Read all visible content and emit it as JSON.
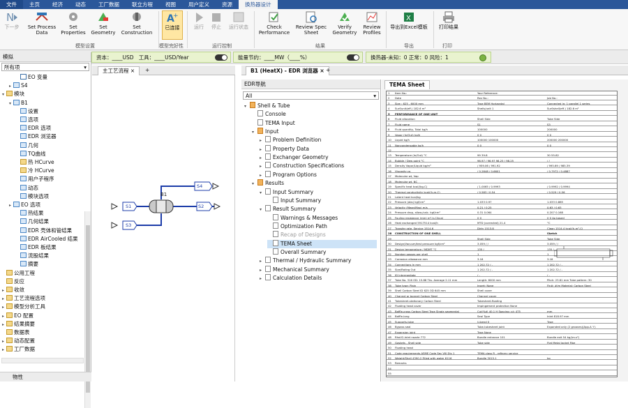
{
  "menu": [
    "文件",
    "主页",
    "经济",
    "动态",
    "工厂数据",
    "联立方程",
    "视图",
    "用户定义",
    "资源",
    "换热器设计"
  ],
  "ribbon": {
    "buttons": [
      {
        "label": "下一步",
        "disabled": true
      },
      {
        "label": "Set Process\nData"
      },
      {
        "label": "Set\nProperties"
      },
      {
        "label": "Set\nGeometry"
      },
      {
        "label": "Set\nConstruction"
      },
      {
        "label": "已连接"
      },
      {
        "label": "运行",
        "disabled": true
      },
      {
        "label": "停止",
        "disabled": true
      },
      {
        "label": "运行状态",
        "disabled": true
      },
      {
        "label": "Check\nPerformance"
      },
      {
        "label": "Review Spec\nSheet"
      },
      {
        "label": "Verify\nGeometry"
      },
      {
        "label": "Review\nProfiles"
      },
      {
        "label": "导出到Excel模板"
      },
      {
        "label": "打印结果"
      }
    ],
    "groups": [
      "模型设置",
      "模型完好性",
      "运行控制",
      "结果",
      "导出",
      "打印"
    ]
  },
  "status": {
    "capital": "资本：____USD",
    "utilities": "工具：____USD/Year",
    "energy": "能量节约：____MW（____%）",
    "hx": "换热器-未知：0  正常：0  风险：1"
  },
  "left": {
    "header": "模拟",
    "filter": "所有项",
    "tree": [
      {
        "t": "EO 变量",
        "lv": 2,
        "tg": "",
        "ic": "doc"
      },
      {
        "t": "S4",
        "lv": 1,
        "tg": "▸",
        "ic": "blk"
      },
      {
        "t": "模块",
        "lv": 0,
        "tg": "▾",
        "ic": "fold"
      },
      {
        "t": "B1",
        "lv": 1,
        "tg": "▾",
        "ic": "blk"
      },
      {
        "t": "设置",
        "lv": 2,
        "tg": "",
        "ic": "blk"
      },
      {
        "t": "选项",
        "lv": 2,
        "tg": "",
        "ic": "blk"
      },
      {
        "t": "EDR 选项",
        "lv": 2,
        "tg": "",
        "ic": "blk"
      },
      {
        "t": "EDR 浏览器",
        "lv": 2,
        "tg": "",
        "ic": "blk"
      },
      {
        "t": "几何",
        "lv": 2,
        "tg": "",
        "ic": "blk"
      },
      {
        "t": "TQ曲线",
        "lv": 2,
        "tg": "",
        "ic": "blk"
      },
      {
        "t": "热 HCurve",
        "lv": 2,
        "tg": "",
        "ic": "fold"
      },
      {
        "t": "冷 HCurve",
        "lv": 2,
        "tg": "",
        "ic": "fold"
      },
      {
        "t": "用户子程序",
        "lv": 2,
        "tg": "",
        "ic": "blk"
      },
      {
        "t": "动态",
        "lv": 2,
        "tg": "",
        "ic": "blk"
      },
      {
        "t": "模块选项",
        "lv": 2,
        "tg": "",
        "ic": "blk"
      },
      {
        "t": "EO 选项",
        "lv": 1,
        "tg": "▸",
        "ic": "blk"
      },
      {
        "t": "热结果",
        "lv": 2,
        "tg": "",
        "ic": "blk"
      },
      {
        "t": "几何结果",
        "lv": 2,
        "tg": "",
        "ic": "blk"
      },
      {
        "t": "EDR 壳体和管结果",
        "lv": 2,
        "tg": "",
        "ic": "blk"
      },
      {
        "t": "EDR AirCooled 结果",
        "lv": 2,
        "tg": "",
        "ic": "blk"
      },
      {
        "t": "EDR 板结果",
        "lv": 2,
        "tg": "",
        "ic": "blk"
      },
      {
        "t": "流股结果",
        "lv": 2,
        "tg": "",
        "ic": "blk"
      },
      {
        "t": "摘要",
        "lv": 2,
        "tg": "",
        "ic": "blk"
      },
      {
        "t": "公用工程",
        "lv": 0,
        "tg": "",
        "ic": "fold"
      },
      {
        "t": "反应",
        "lv": 0,
        "tg": "",
        "ic": "fold"
      },
      {
        "t": "收敛",
        "lv": 0,
        "tg": "▸",
        "ic": "fold"
      },
      {
        "t": "工艺流程选项",
        "lv": 0,
        "tg": "▸",
        "ic": "fold"
      },
      {
        "t": "模型分析工具",
        "lv": 0,
        "tg": "▸",
        "ic": "fold"
      },
      {
        "t": "EO 配置",
        "lv": 0,
        "tg": "▸",
        "ic": "fold"
      },
      {
        "t": "结果摘要",
        "lv": 0,
        "tg": "▸",
        "ic": "fold"
      },
      {
        "t": "数据表",
        "lv": 0,
        "tg": "",
        "ic": "fold"
      },
      {
        "t": "动态配置",
        "lv": 0,
        "tg": "▸",
        "ic": "fold"
      },
      {
        "t": "工厂数据",
        "lv": 0,
        "tg": "▸",
        "ic": "fold"
      }
    ],
    "bottom": "物性"
  },
  "mid": {
    "tab": "主工艺流程",
    "block": "B1",
    "streams": [
      "S1",
      "S2",
      "S3",
      "S4"
    ]
  },
  "right": {
    "tab": "B1 (HeatX) - EDR 浏览器",
    "nav_header": "EDR导航",
    "nav_filter": "All",
    "doc_tab": "TEMA Sheet",
    "nav": [
      {
        "t": "Shell & Tube",
        "lv": 0,
        "ar": "▾",
        "ic": "fd"
      },
      {
        "t": "Console",
        "lv": 1,
        "ar": "",
        "ic": "pg"
      },
      {
        "t": "TEMA Input",
        "lv": 1,
        "ar": "",
        "ic": "pg"
      },
      {
        "t": "Input",
        "lv": 1,
        "ar": "▾",
        "ic": "fd"
      },
      {
        "t": "Problem Definition",
        "lv": 2,
        "ar": "▸",
        "ic": "pg"
      },
      {
        "t": "Property Data",
        "lv": 2,
        "ar": "▸",
        "ic": "pg"
      },
      {
        "t": "Exchanger Geometry",
        "lv": 2,
        "ar": "▸",
        "ic": "pg"
      },
      {
        "t": "Construction Specifications",
        "lv": 2,
        "ar": "▸",
        "ic": "pg"
      },
      {
        "t": "Program Options",
        "lv": 2,
        "ar": "▸",
        "ic": "pg"
      },
      {
        "t": "Results",
        "lv": 1,
        "ar": "▾",
        "ic": "fd"
      },
      {
        "t": "Input Summary",
        "lv": 2,
        "ar": "▾",
        "ic": "pg"
      },
      {
        "t": "Input Summary",
        "lv": 3,
        "ar": "",
        "ic": "pg"
      },
      {
        "t": "Result Summary",
        "lv": 2,
        "ar": "▾",
        "ic": "pg"
      },
      {
        "t": "Warnings & Messages",
        "lv": 3,
        "ar": "",
        "ic": "pg"
      },
      {
        "t": "Optimization Path",
        "lv": 3,
        "ar": "",
        "ic": "pg"
      },
      {
        "t": "Recap of Designs",
        "lv": 3,
        "ar": "",
        "ic": "pg",
        "gray": true
      },
      {
        "t": "TEMA Sheet",
        "lv": 3,
        "ar": "",
        "ic": "pg",
        "sel": true
      },
      {
        "t": "Overall Summary",
        "lv": 3,
        "ar": "",
        "ic": "pg"
      },
      {
        "t": "Thermal / Hydraulic Summary",
        "lv": 2,
        "ar": "▸",
        "ic": "pg"
      },
      {
        "t": "Mechanical Summary",
        "lv": 2,
        "ar": "▸",
        "ic": "pg"
      },
      {
        "t": "Calculation Details",
        "lv": 2,
        "ar": "▸",
        "ic": "pg"
      }
    ]
  },
  "tema": [
    {
      "n": "1",
      "a": "Item No.:",
      "b": "Your Reference:",
      "c": "",
      "d": ""
    },
    {
      "n": "2",
      "a": "Date",
      "b": "Rev No.:",
      "c": "Job No.:",
      "d": ""
    },
    {
      "n": "3",
      "a": "Size :  625 - 6000   mm",
      "b": "Type  BEM   Horizontal",
      "c": "Connected in:  1  parallel   1  series",
      "d": ""
    },
    {
      "n": "4",
      "a": "Surf/unit(eff.)    182.6   m²",
      "b": "Shells/unit   1",
      "c": "Surf/shell(eff.)   182.6   m²",
      "d": ""
    },
    {
      "n": "5",
      "a": "PERFORMANCE OF ONE UNIT",
      "b": "",
      "c": "",
      "d": "",
      "hd": true
    },
    {
      "n": "6",
      "a": "Fluid allocation",
      "b": "Shell Side",
      "c": "Tube Side",
      "d": ""
    },
    {
      "n": "7",
      "a": "Fluid name",
      "b": "S1",
      "c": "S3",
      "d": ""
    },
    {
      "n": "8",
      "a": "Fluid quantity, Total   kg/h",
      "b": "100000",
      "c": "200000",
      "d": ""
    },
    {
      "n": "9",
      "a": "Vapor (In/Out)   kg/h",
      "b": "0     0",
      "c": "0     0",
      "d": ""
    },
    {
      "n": "10",
      "a": "Liquid   kg/h",
      "b": "100000   100000",
      "c": "200000   200000",
      "d": ""
    },
    {
      "n": "11",
      "a": "Noncondensable   kg/h",
      "b": "0     0",
      "c": "0     0",
      "d": ""
    },
    {
      "n": "12",
      "a": "",
      "b": "",
      "c": "",
      "d": ""
    },
    {
      "n": "13",
      "a": "Temperature (In/Out)   °C",
      "b": "99     39.8",
      "c": "30     55.82",
      "d": ""
    },
    {
      "n": "14",
      "a": "Bubble / Dew point   °C",
      "b": "96.97 / 96.97   98.25 / 98.25",
      "c": "/     /",
      "d": ""
    },
    {
      "n": "15",
      "a": "Density  Vapor/Liquid   kg/m³",
      "b": "/ 959.06   / 991.92",
      "c": "/ 995.69   / 985.39",
      "d": ""
    },
    {
      "n": "16",
      "a": "Viscosity   cp",
      "b": "/ 0.2848   / 0.6601",
      "c": "/ 0.7972   / 0.4887",
      "d": ""
    },
    {
      "n": "17",
      "a": "Molecular wt, Vap",
      "b": "",
      "c": "",
      "d": ""
    },
    {
      "n": "18",
      "a": "Molecular wt, NC",
      "b": "",
      "c": "",
      "d": ""
    },
    {
      "n": "19",
      "a": "Specific heat   kcal/(kg-C)",
      "b": "/ 1.0065   / 0.9993",
      "c": "/ 0.9992   / 0.9994",
      "d": ""
    },
    {
      "n": "20",
      "a": "Thermal conductivity   kcal/(h-m-C)",
      "b": "/ 0.583   / 0.54",
      "c": "/ 0.529   / 0.56",
      "d": ""
    },
    {
      "n": "21",
      "a": "Latent heat   kcal/kg",
      "b": "",
      "c": "",
      "d": ""
    },
    {
      "n": "22",
      "a": "Pressure (abs)   kgf/cm²",
      "b": "1.033     0.97",
      "c": "1.033     0.865",
      "d": ""
    },
    {
      "n": "23",
      "a": "Velocity (Mean/Max)   m/s",
      "b": "0.21 / 0.25",
      "c": "0.63 / 0.63",
      "d": ""
    },
    {
      "n": "24",
      "a": "Pressure drop, allow./calc.   kgf/cm²",
      "b": "0.31     0.064",
      "c": "0.207     0.168",
      "d": ""
    },
    {
      "n": "25",
      "a": "Fouling resistance (min)   m²-h-C/kcal",
      "b": "0     0",
      "c": "0     0  Ao based",
      "d": ""
    },
    {
      "n": "26",
      "a": "Heat exchanged   5917514   kcal/h",
      "b": "MTD (corrected)   21.4",
      "c": "°C",
      "d": ""
    },
    {
      "n": "27",
      "a": "Transfer rate, Service   1514.6",
      "b": "Dirty   1513.8",
      "c": "Clean   1514.4   kcal/(h-m²-C)",
      "d": ""
    },
    {
      "n": "28",
      "a": "CONSTRUCTION OF ONE SHELL",
      "b": "",
      "c": "Sketch",
      "d": "",
      "hd": true
    },
    {
      "n": "29",
      "a": "",
      "b": "Shell Side",
      "c": "Tube Side",
      "d": ""
    },
    {
      "n": "30",
      "a": "Design/Vacuum/test pressure   kgf/cm²",
      "b": "3.059 /   /",
      "c": "3.059 /   /",
      "d": ""
    },
    {
      "n": "31",
      "a": "Design temperature / MDMT   °C",
      "b": "135 /",
      "c": "135 /",
      "d": ""
    },
    {
      "n": "32",
      "a": "Number passes per shell",
      "b": "1",
      "c": "1",
      "d": ""
    },
    {
      "n": "33",
      "a": "Corrosion allowance   mm",
      "b": "3.18",
      "c": "3.18",
      "d": ""
    },
    {
      "n": "34",
      "a": "Connections   In   mm",
      "b": "1   202.72 /   -",
      "c": "1   202.72 /   -",
      "d": ""
    },
    {
      "n": "35",
      "a": "Size/Rating   Out",
      "b": "1   202.72 /   -",
      "c": "1   202.72 /   -",
      "d": ""
    },
    {
      "n": "36",
      "a": "ID   Intermediate",
      "b": "/   -",
      "c": "/   -",
      "d": ""
    },
    {
      "n": "37",
      "a": "Tube No.  316   OD:  15.88   Tks. Average  2.11  mm",
      "b": "Length:  6000  mm",
      "c": "Pitch:  23.81  mm   Tube pattern: 30",
      "d": ""
    },
    {
      "n": "38",
      "a": "Tube type: Plain",
      "b": "Insert: None",
      "c": "Fin#:     #/m   Material: Carbon Steel",
      "d": ""
    },
    {
      "n": "39",
      "a": "Shell   Carbon Steel   ID  625   OD  645  mm",
      "b": "Shell cover",
      "c": "",
      "d": ""
    },
    {
      "n": "40",
      "a": "Channel or bonnet   Carbon Steel",
      "b": "Channel cover",
      "c": "",
      "d": ""
    },
    {
      "n": "41",
      "a": "Tubesheet-stationary   Carbon Steel",
      "b": "Tubesheet-floating",
      "c": "",
      "d": ""
    },
    {
      "n": "42",
      "a": "Floating head cover",
      "b": "Impingement protection   None",
      "c": "",
      "d": ""
    },
    {
      "n": "43",
      "a": "Baffle-cross   Carbon Steel   Type  Single segmental",
      "b": "Cut(%d)  40.1   H  Spacing: c/c  475",
      "c": "mm",
      "d": ""
    },
    {
      "n": "44",
      "a": "Baffle-long",
      "b": "Seal Type",
      "c": "Inlet   818.97   mm",
      "d": ""
    },
    {
      "n": "45",
      "a": "Supports-tube",
      "b": "U-bend   0",
      "c": "Type",
      "d": ""
    },
    {
      "n": "46",
      "a": "Bypass seal",
      "b": "Tube-tubesheet joint",
      "c": "Expanded only (2 grooves)(App.A 'i')",
      "d": ""
    },
    {
      "n": "47",
      "a": "Expansion joint",
      "b": "Type   None",
      "c": "",
      "d": ""
    },
    {
      "n": "48",
      "a": "RhoV2-Inlet nozzle   772",
      "b": "Bundle entrance   101",
      "c": "Bundle exit   54   kg/(m-s²)",
      "d": ""
    },
    {
      "n": "49",
      "a": "Gaskets - Shell side",
      "b": "Tube side",
      "c": "Flat Metal Jacket Fibe",
      "d": ""
    },
    {
      "n": "50",
      "a": "Floating head",
      "b": "",
      "c": "",
      "d": ""
    },
    {
      "n": "51",
      "a": "Code requirements   ASME Code Sec VIII Div 1",
      "b": "TEMA class   R - refinery service",
      "c": "",
      "d": ""
    },
    {
      "n": "52",
      "a": "Weight/Shell   4390.2   Filled with water   6116",
      "b": "Bundle   3015.1",
      "c": "kg",
      "d": ""
    },
    {
      "n": "53",
      "a": "Remarks",
      "b": "",
      "c": "",
      "d": ""
    },
    {
      "n": "54",
      "a": "",
      "b": "",
      "c": "",
      "d": ""
    },
    {
      "n": "55",
      "a": "",
      "b": "",
      "c": "",
      "d": ""
    }
  ]
}
